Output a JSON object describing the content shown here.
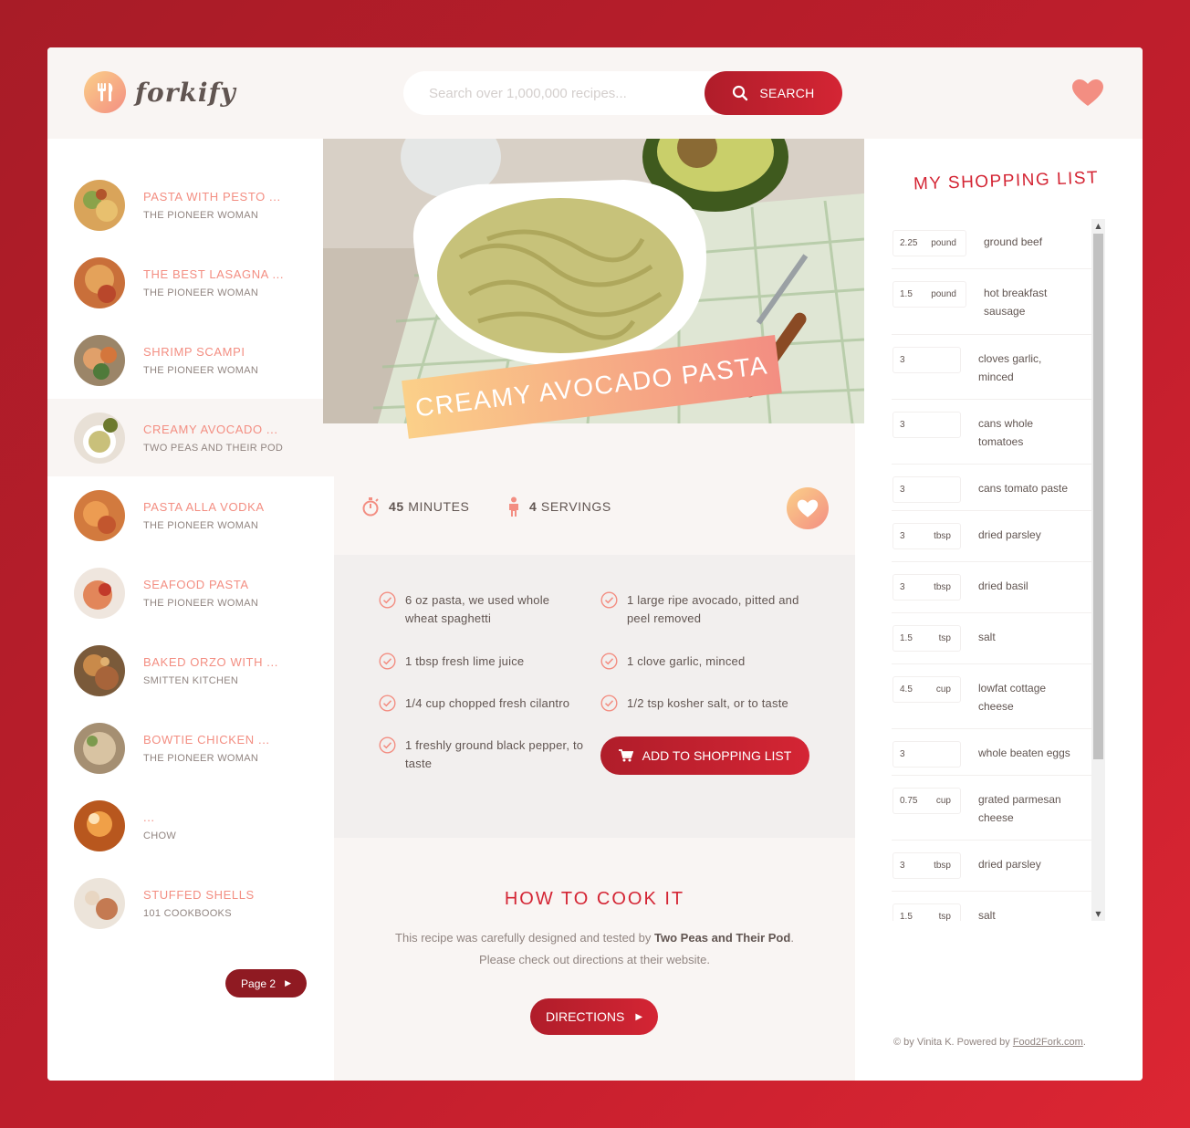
{
  "header": {
    "logo_text": "forkify",
    "search_placeholder": "Search over 1,000,000 recipes...",
    "search_button": "SEARCH"
  },
  "results": [
    {
      "title": "PASTA WITH PESTO ...",
      "author": "THE PIONEER WOMAN"
    },
    {
      "title": "THE BEST LASAGNA ...",
      "author": "THE PIONEER WOMAN"
    },
    {
      "title": "SHRIMP SCAMPI",
      "author": "THE PIONEER WOMAN"
    },
    {
      "title": "CREAMY AVOCADO ...",
      "author": "TWO PEAS AND THEIR POD",
      "active": true
    },
    {
      "title": "PASTA ALLA VODKA",
      "author": "THE PIONEER WOMAN"
    },
    {
      "title": "SEAFOOD PASTA",
      "author": "THE PIONEER WOMAN"
    },
    {
      "title": "BAKED ORZO WITH ...",
      "author": "SMITTEN KITCHEN"
    },
    {
      "title": "BOWTIE CHICKEN ...",
      "author": "THE PIONEER WOMAN"
    },
    {
      "title": "...",
      "author": "CHOW"
    },
    {
      "title": "STUFFED SHELLS",
      "author": "101 COOKBOOKS"
    }
  ],
  "pagination": {
    "label": "Page 2"
  },
  "recipe": {
    "title": "CREAMY AVOCADO PASTA",
    "time_value": "45",
    "time_unit": "MINUTES",
    "servings_value": "4",
    "servings_unit": "SERVINGS",
    "ingredients": [
      "6 oz pasta, we used whole wheat spaghetti",
      "1 large ripe avocado, pitted and peel removed",
      "1 tbsp fresh lime juice",
      "1 clove garlic, minced",
      "1/4 cup chopped fresh cilantro",
      "1/2 tsp kosher salt, or to taste",
      "1 freshly ground black pepper, to taste"
    ],
    "add_to_list": "ADD TO SHOPPING LIST"
  },
  "howto": {
    "title": "HOW TO COOK IT",
    "text_before": "This recipe was carefully designed and tested by ",
    "publisher": "Two Peas and Their Pod",
    "text_after": ". Please check out directions at their website.",
    "button": "DIRECTIONS"
  },
  "shopping": {
    "title": "MY SHOPPING LIST",
    "items": [
      {
        "count": "2.25",
        "unit": "pound",
        "name": "ground beef"
      },
      {
        "count": "1.5",
        "unit": "pound",
        "name": "hot breakfast sausage"
      },
      {
        "count": "3",
        "unit": "",
        "name": "cloves garlic, minced"
      },
      {
        "count": "3",
        "unit": "",
        "name": "cans whole tomatoes"
      },
      {
        "count": "3",
        "unit": "",
        "name": "cans tomato paste"
      },
      {
        "count": "3",
        "unit": "tbsp",
        "name": "dried parsley"
      },
      {
        "count": "3",
        "unit": "tbsp",
        "name": "dried basil"
      },
      {
        "count": "1.5",
        "unit": "tsp",
        "name": "salt"
      },
      {
        "count": "4.5",
        "unit": "cup",
        "name": "lowfat cottage cheese"
      },
      {
        "count": "3",
        "unit": "",
        "name": "whole beaten eggs"
      },
      {
        "count": "0.75",
        "unit": "cup",
        "name": "grated parmesan cheese"
      },
      {
        "count": "3",
        "unit": "tbsp",
        "name": "dried parsley"
      },
      {
        "count": "1.5",
        "unit": "tsp",
        "name": "salt"
      }
    ]
  },
  "footer": {
    "copyright": "© by Vinita K. Powered by ",
    "link": "Food2Fork.com",
    "end": "."
  },
  "colors": {
    "accent": "#f38e82",
    "brand_red": "#d42534",
    "dark_red": "#8f1a22",
    "text": "#615551",
    "muted": "#918581"
  }
}
